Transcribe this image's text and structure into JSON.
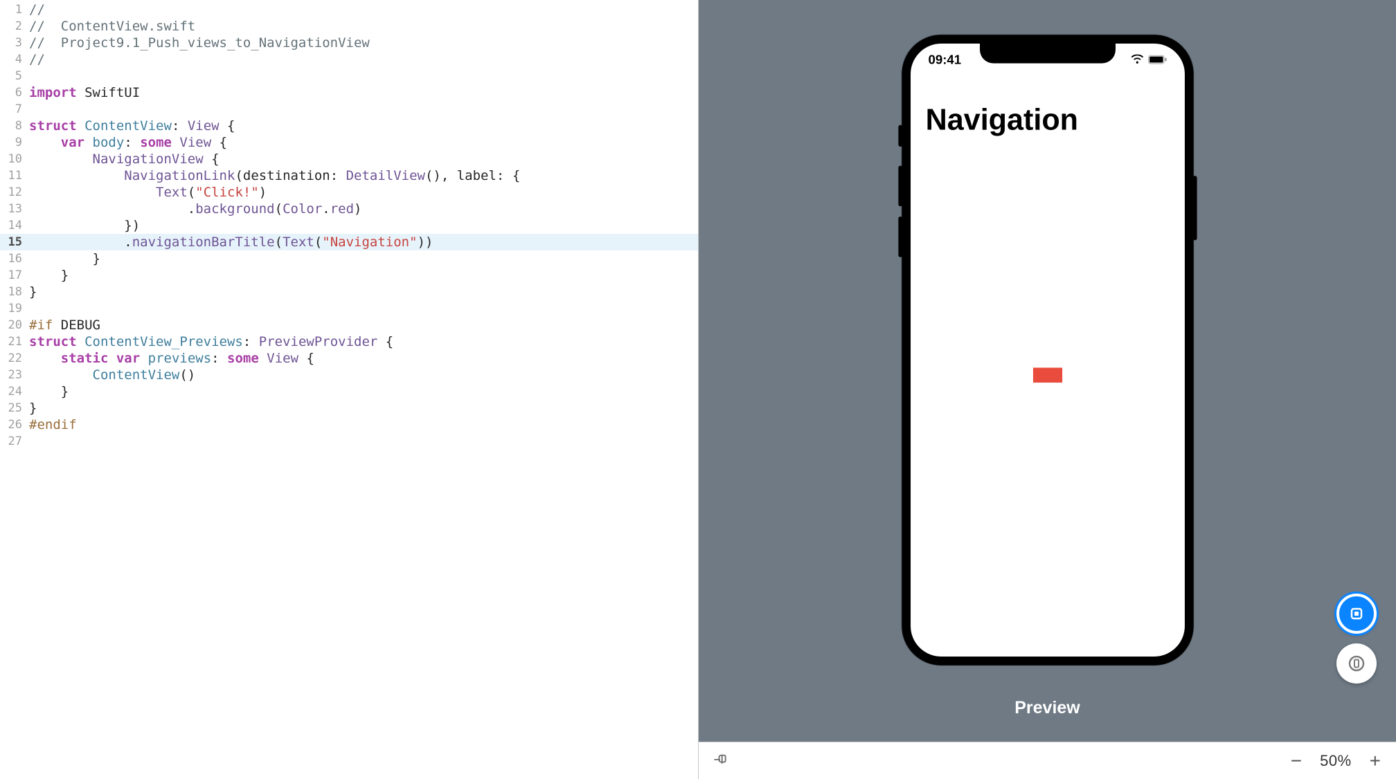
{
  "editor": {
    "highlight_line": 15,
    "lines": [
      {
        "n": 1,
        "tokens": [
          {
            "c": "cmt",
            "t": "//"
          }
        ]
      },
      {
        "n": 2,
        "tokens": [
          {
            "c": "cmt",
            "t": "//  ContentView.swift"
          }
        ]
      },
      {
        "n": 3,
        "tokens": [
          {
            "c": "cmt",
            "t": "//  Project9.1_Push_views_to_NavigationView"
          }
        ]
      },
      {
        "n": 4,
        "tokens": [
          {
            "c": "cmt",
            "t": "//"
          }
        ]
      },
      {
        "n": 5,
        "tokens": []
      },
      {
        "n": 6,
        "tokens": [
          {
            "c": "kw",
            "t": "import"
          },
          {
            "c": "txt",
            "t": " "
          },
          {
            "c": "txt",
            "t": "SwiftUI"
          }
        ]
      },
      {
        "n": 7,
        "tokens": []
      },
      {
        "n": 8,
        "tokens": [
          {
            "c": "kw",
            "t": "struct"
          },
          {
            "c": "txt",
            "t": " "
          },
          {
            "c": "dec",
            "t": "ContentView"
          },
          {
            "c": "txt",
            "t": ": "
          },
          {
            "c": "typeP",
            "t": "View"
          },
          {
            "c": "txt",
            "t": " {"
          }
        ]
      },
      {
        "n": 9,
        "tokens": [
          {
            "c": "txt",
            "t": "    "
          },
          {
            "c": "kw",
            "t": "var"
          },
          {
            "c": "txt",
            "t": " "
          },
          {
            "c": "dec",
            "t": "body"
          },
          {
            "c": "txt",
            "t": ": "
          },
          {
            "c": "kw",
            "t": "some"
          },
          {
            "c": "txt",
            "t": " "
          },
          {
            "c": "typeP",
            "t": "View"
          },
          {
            "c": "txt",
            "t": " {"
          }
        ]
      },
      {
        "n": 10,
        "tokens": [
          {
            "c": "txt",
            "t": "        "
          },
          {
            "c": "typeP",
            "t": "NavigationView"
          },
          {
            "c": "txt",
            "t": " {"
          }
        ]
      },
      {
        "n": 11,
        "tokens": [
          {
            "c": "txt",
            "t": "            "
          },
          {
            "c": "typeP",
            "t": "NavigationLink"
          },
          {
            "c": "txt",
            "t": "(destination: "
          },
          {
            "c": "typeP",
            "t": "DetailView"
          },
          {
            "c": "txt",
            "t": "(), label: {"
          }
        ]
      },
      {
        "n": 12,
        "tokens": [
          {
            "c": "txt",
            "t": "                "
          },
          {
            "c": "typeP",
            "t": "Text"
          },
          {
            "c": "txt",
            "t": "("
          },
          {
            "c": "str",
            "t": "\"Click!\""
          },
          {
            "c": "txt",
            "t": ")"
          }
        ]
      },
      {
        "n": 13,
        "tokens": [
          {
            "c": "txt",
            "t": "                    ."
          },
          {
            "c": "prop",
            "t": "background"
          },
          {
            "c": "txt",
            "t": "("
          },
          {
            "c": "typeP",
            "t": "Color"
          },
          {
            "c": "txt",
            "t": "."
          },
          {
            "c": "prop",
            "t": "red"
          },
          {
            "c": "txt",
            "t": ")"
          }
        ]
      },
      {
        "n": 14,
        "tokens": [
          {
            "c": "txt",
            "t": "            })"
          }
        ]
      },
      {
        "n": 15,
        "tokens": [
          {
            "c": "txt",
            "t": "            ."
          },
          {
            "c": "prop",
            "t": "navigationBarTitle"
          },
          {
            "c": "txt",
            "t": "("
          },
          {
            "c": "typeP",
            "t": "Text"
          },
          {
            "c": "txt",
            "t": "("
          },
          {
            "c": "str",
            "t": "\"Navigation\""
          },
          {
            "c": "txt",
            "t": "))"
          }
        ]
      },
      {
        "n": 16,
        "tokens": [
          {
            "c": "txt",
            "t": "        }"
          }
        ]
      },
      {
        "n": 17,
        "tokens": [
          {
            "c": "txt",
            "t": "    }"
          }
        ]
      },
      {
        "n": 18,
        "tokens": [
          {
            "c": "txt",
            "t": "}"
          }
        ]
      },
      {
        "n": 19,
        "tokens": []
      },
      {
        "n": 20,
        "tokens": [
          {
            "c": "prep",
            "t": "#if"
          },
          {
            "c": "txt",
            "t": " DEBUG"
          }
        ]
      },
      {
        "n": 21,
        "tokens": [
          {
            "c": "kw",
            "t": "struct"
          },
          {
            "c": "txt",
            "t": " "
          },
          {
            "c": "dec",
            "t": "ContentView_Previews"
          },
          {
            "c": "txt",
            "t": ": "
          },
          {
            "c": "typeP",
            "t": "PreviewProvider"
          },
          {
            "c": "txt",
            "t": " {"
          }
        ]
      },
      {
        "n": 22,
        "tokens": [
          {
            "c": "txt",
            "t": "    "
          },
          {
            "c": "kw",
            "t": "static"
          },
          {
            "c": "txt",
            "t": " "
          },
          {
            "c": "kw",
            "t": "var"
          },
          {
            "c": "txt",
            "t": " "
          },
          {
            "c": "dec",
            "t": "previews"
          },
          {
            "c": "txt",
            "t": ": "
          },
          {
            "c": "kw",
            "t": "some"
          },
          {
            "c": "txt",
            "t": " "
          },
          {
            "c": "typeP",
            "t": "View"
          },
          {
            "c": "txt",
            "t": " {"
          }
        ]
      },
      {
        "n": 23,
        "tokens": [
          {
            "c": "txt",
            "t": "        "
          },
          {
            "c": "dec",
            "t": "ContentView"
          },
          {
            "c": "txt",
            "t": "()"
          }
        ]
      },
      {
        "n": 24,
        "tokens": [
          {
            "c": "txt",
            "t": "    }"
          }
        ]
      },
      {
        "n": 25,
        "tokens": [
          {
            "c": "txt",
            "t": "}"
          }
        ]
      },
      {
        "n": 26,
        "tokens": [
          {
            "c": "prep",
            "t": "#endif"
          }
        ]
      },
      {
        "n": 27,
        "tokens": []
      }
    ]
  },
  "preview": {
    "status_time": "09:41",
    "nav_title": "Navigation",
    "label": "Preview"
  },
  "toolbar": {
    "zoom": "50%"
  }
}
